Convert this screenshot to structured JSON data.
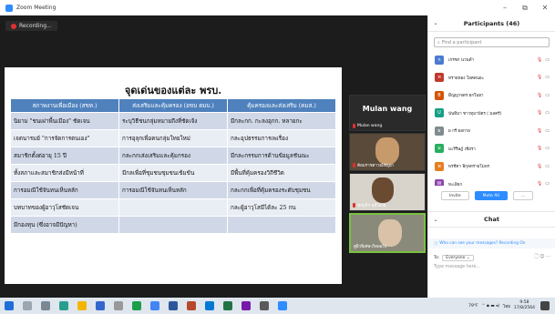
{
  "window": {
    "title": "Zoom Meeting",
    "controls": [
      "–",
      "⧉",
      "✕"
    ]
  },
  "recording": {
    "label": "Recording..."
  },
  "slide": {
    "title": "จุดเด่นของแต่ละ พรบ.",
    "headers": [
      "สภาพงานเพื่อเมือง (สขท.)",
      "ส่งเสริมและคุ้มครอง (อขบ ตมบ.)",
      "คุ้มครองและส่งเสริม (คมส.)"
    ],
    "rows": [
      [
        "นิยาม \"ชนเผ่าพื้นเมือง\" ชัดเจน",
        "ระบุวิธีชนกลุ่มหมายถึงที่ชัดเจ้ง",
        "มีกละกก. กะลงอุกก. หลายกะ"
      ],
      [
        "เจตนารมย์ \"การจัดการตนเอง\"",
        "การอุลุกเพื่อคนกลุ่มใทยใหม่",
        "กละอุปธรรมการเพเรื่อง"
      ],
      [
        "สมาชิกตั้งต่อายุ 15 ปี",
        "กละกกเส่งเสริมและคุ้มกรอง",
        "มีกละกรรมการด้านข้อมูลชันณะ"
      ],
      [
        "ทั้งสภาและสมาชิกส่งมีหน้าที่",
        "มีกลเพื่อที่ชุมชนชุมชนเข้มข้น",
        "มีพื้นที่คุ้มครองวิถีชีวิต"
      ],
      [
        "การอมณีใช้จันทนเห็นหลัก",
        "การอมณีใช้จันทนเห็นหลัก",
        "กละกกเพื่อที่คุ้มครองระดับชุมชน"
      ],
      [
        "บทบาทของผู้อาวุโสชัดเจน",
        "",
        "กละผู้อาวุโสมีได้ละ 25 กน"
      ],
      [
        "มีกองทุน (ซึ่งอาจมีปัญหา)",
        "",
        ""
      ]
    ]
  },
  "tiles": [
    {
      "name": "Mulan wang",
      "big_label": "Mulan wang"
    },
    {
      "name": "ค้อมราชสาวณ์ชัญเก"
    },
    {
      "name": "นักมุกิก อลิโลวอ"
    },
    {
      "name": "ดูผิวพิเศษ-ภิลพอใจ"
    }
  ],
  "participants_panel": {
    "title": "Participants (46)",
    "search_placeholder": "Find a participant",
    "items": [
      {
        "initial": "ก",
        "name": "เกรซก นวนดำ",
        "color": "#4a7bd0"
      },
      {
        "initial": "ท",
        "name": "ทรายทอง โยคตนอะ",
        "color": "#c0392b"
      },
      {
        "initial": "B",
        "name": "Bิญญาจตร ผกในยา",
        "color": "#d35400"
      },
      {
        "initial": "U",
        "name": "นันทิมา ชาวทุมาปัตร ( มลครี)",
        "color": "#16a085"
      },
      {
        "initial": "ผ",
        "name": "ผ กรี ผลกาย",
        "color": "#7f8c8d"
      },
      {
        "initial": "ม",
        "name": "มะรีริษฎ์ เชียรา",
        "color": "#27ae60"
      },
      {
        "initial": "พ",
        "name": "พรชีตา พิกุลทรายโมพร",
        "color": "#e67e22"
      },
      {
        "initial": "W",
        "name": "ทะเลิยก",
        "color": "#8e44ad"
      }
    ],
    "invite_label": "Invite",
    "mute_all_label": "Mute All",
    "more_label": "..."
  },
  "chat": {
    "title": "Chat",
    "notice": "Who can see your messages? Recording On",
    "to_label": "To:",
    "to_value": "Everyone",
    "placeholder": "Type message here..."
  },
  "taskbar": {
    "weather": "79°F",
    "time": "9:58",
    "date": "17/8/2564",
    "lang": "ไทย"
  }
}
